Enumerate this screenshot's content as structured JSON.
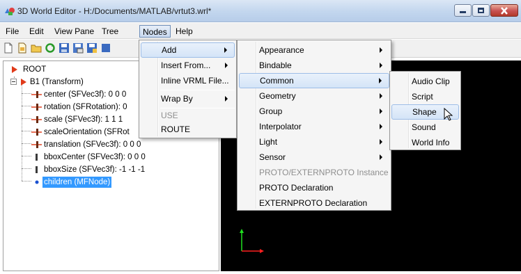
{
  "window": {
    "title": "3D World Editor - H:/Documents/MATLAB/vrtut3.wrl*"
  },
  "menubar": {
    "items": [
      "File",
      "Edit",
      "View Pane",
      "Tree",
      "Nodes",
      "Help"
    ],
    "active": "Nodes"
  },
  "tree": {
    "root": "ROOT",
    "transform": "B1 (Transform)",
    "fields": [
      "center (SFVec3f): 0 0 0",
      "rotation (SFRotation): 0",
      "scale (SFVec3f): 1 1 1",
      "scaleOrientation (SFRot",
      "translation (SFVec3f): 0 0 0",
      "bboxCenter (SFVec3f): 0 0 0",
      "bboxSize (SFVec3f): -1 -1 -1",
      "children (MFNode)"
    ]
  },
  "nodes_menu": {
    "add": "Add",
    "insert_from": "Insert From...",
    "inline_vrml": "Inline VRML File...",
    "wrap_by": "Wrap By",
    "use": "USE",
    "route": "ROUTE"
  },
  "add_menu": {
    "items": [
      "Appearance",
      "Bindable",
      "Common",
      "Geometry",
      "Group",
      "Interpolator",
      "Light",
      "Sensor",
      "PROTO/EXTERNPROTO Instance",
      "PROTO Declaration",
      "EXTERNPROTO Declaration"
    ]
  },
  "common_menu": {
    "items": [
      "Audio Clip",
      "Script",
      "Shape",
      "Sound",
      "World Info"
    ]
  },
  "colors": {
    "selection": "#3399ff",
    "root_arrow": "#e03a1a",
    "canvas_bg": "#000000",
    "axis_x": "#ff2020",
    "axis_y": "#20e020"
  }
}
